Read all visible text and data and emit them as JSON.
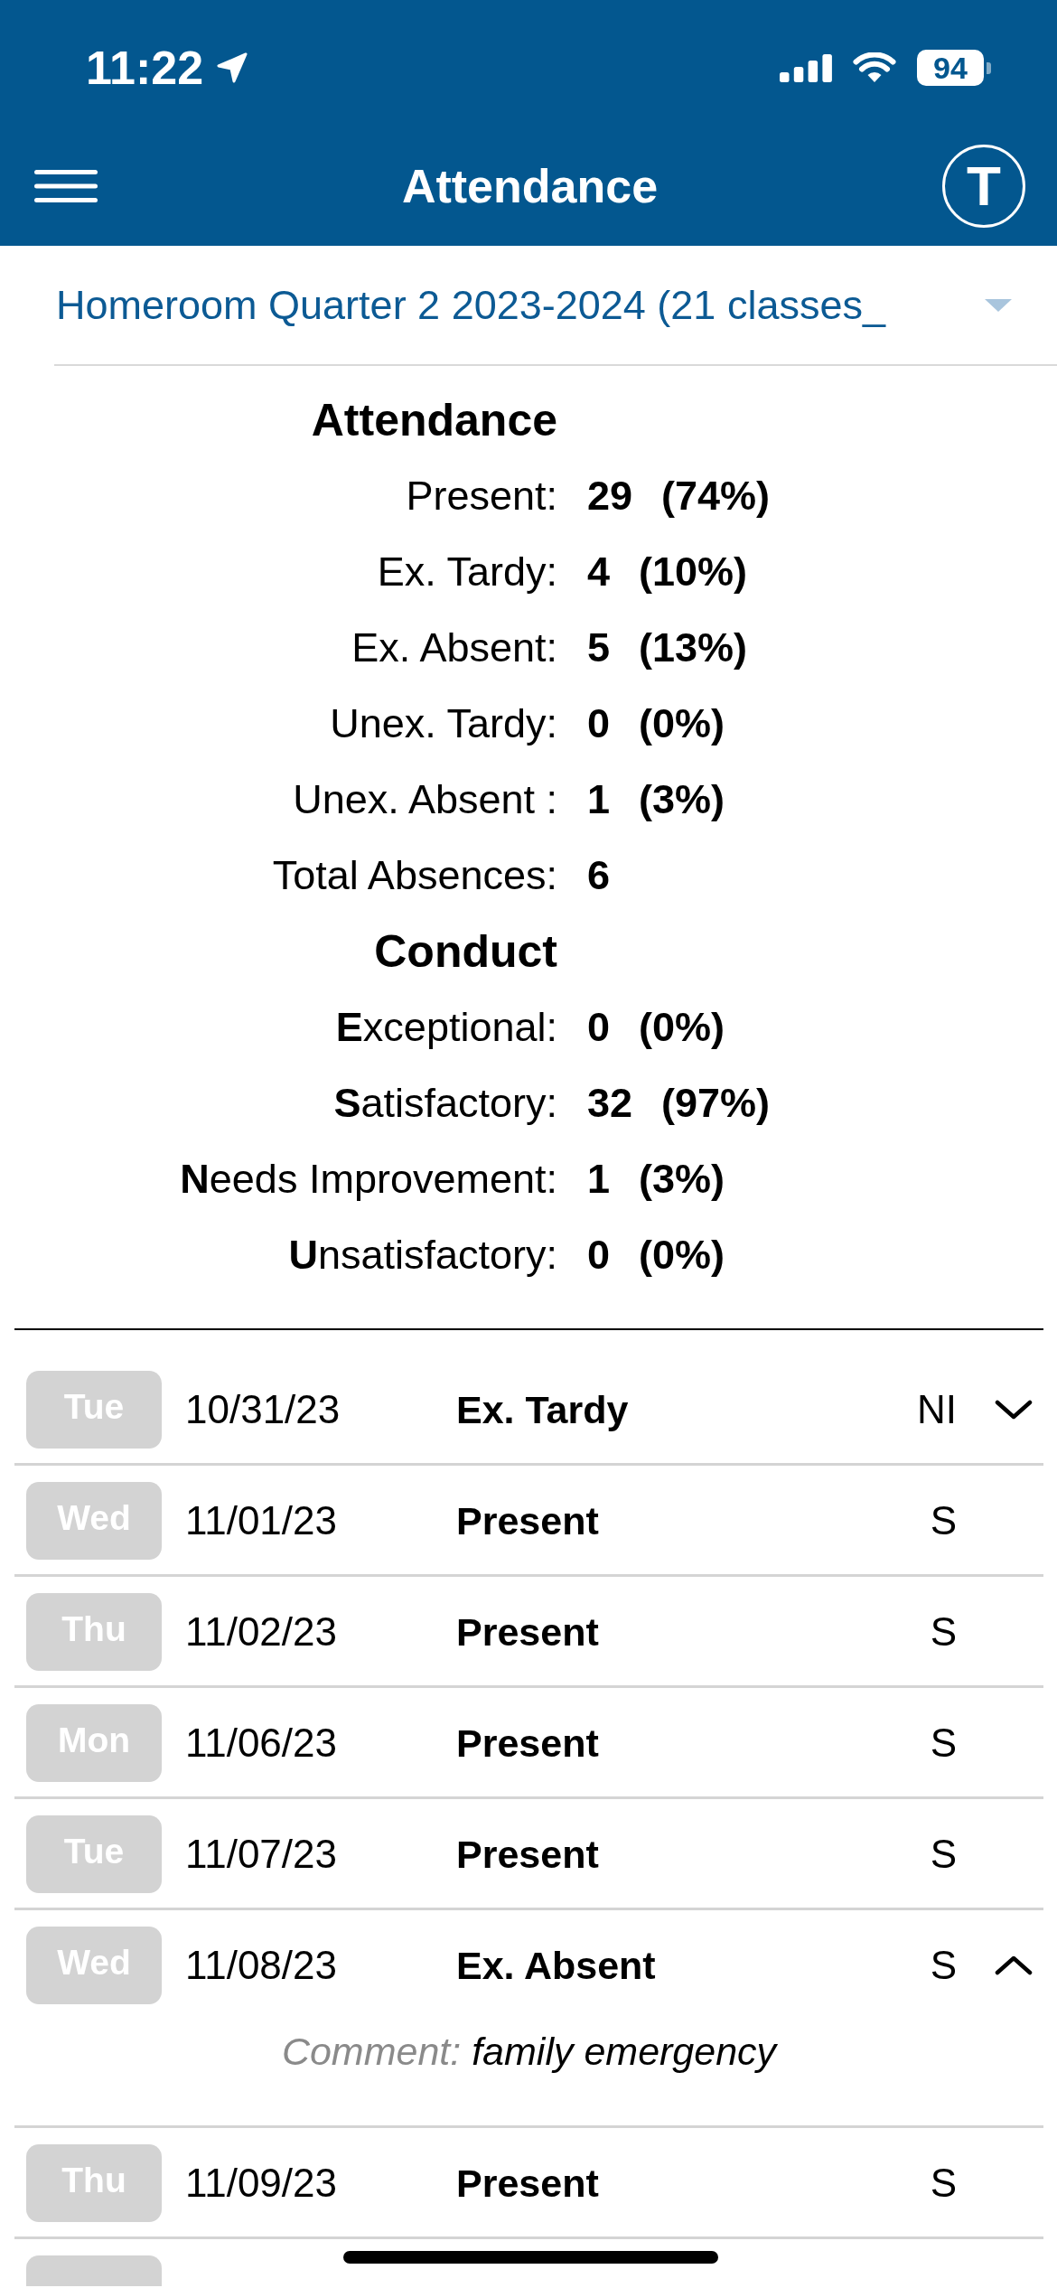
{
  "status_bar": {
    "time": "11:22",
    "battery": "94"
  },
  "header": {
    "title": "Attendance",
    "avatar_letter": "T"
  },
  "term_picker": {
    "value": "Homeroom Quarter 2 2023-2024 (21 classes_"
  },
  "summary": [
    {
      "heading": "Attendance",
      "rows": [
        {
          "label": "Present:",
          "count": "29",
          "percent": "(74%)"
        },
        {
          "label": "Ex. Tardy:",
          "count": "4",
          "percent": "(10%)"
        },
        {
          "label": "Ex. Absent:",
          "count": "5",
          "percent": "(13%)"
        },
        {
          "label": "Unex. Tardy:",
          "count": "0",
          "percent": "(0%)"
        },
        {
          "label": "Unex. Absent :",
          "count": "1",
          "percent": "(3%)"
        },
        {
          "label": "Total Absences:",
          "count": "6"
        }
      ]
    },
    {
      "heading": "Conduct",
      "rows": [
        {
          "label": "**E**xceptional:",
          "count": "0",
          "percent": "(0%)"
        },
        {
          "label": "**S**atisfactory:",
          "count": "32",
          "percent": "(97%)"
        },
        {
          "label": "**N**eeds Improvement:",
          "count": "1",
          "percent": "(3%)"
        },
        {
          "label": "**U**nsatisfactory:",
          "count": "0",
          "percent": "(0%)"
        }
      ]
    }
  ],
  "days": [
    {
      "day": "Tue",
      "date": "10/31/23",
      "status": "Ex. Tardy",
      "grade": "NI",
      "expanded": false
    },
    {
      "day": "Wed",
      "date": "11/01/23",
      "status": "Present",
      "grade": "S"
    },
    {
      "day": "Thu",
      "date": "11/02/23",
      "status": "Present",
      "grade": "S"
    },
    {
      "day": "Mon",
      "date": "11/06/23",
      "status": "Present",
      "grade": "S"
    },
    {
      "day": "Tue",
      "date": "11/07/23",
      "status": "Present",
      "grade": "S"
    },
    {
      "day": "Wed",
      "date": "11/08/23",
      "status": "Ex. Absent",
      "grade": "S",
      "expanded": true,
      "comment": {
        "label": "Comment:",
        "text": "family emergency"
      }
    },
    {
      "day": "Thu",
      "date": "11/09/23",
      "status": "Present",
      "grade": "S"
    }
  ],
  "more_rows_below": true
}
